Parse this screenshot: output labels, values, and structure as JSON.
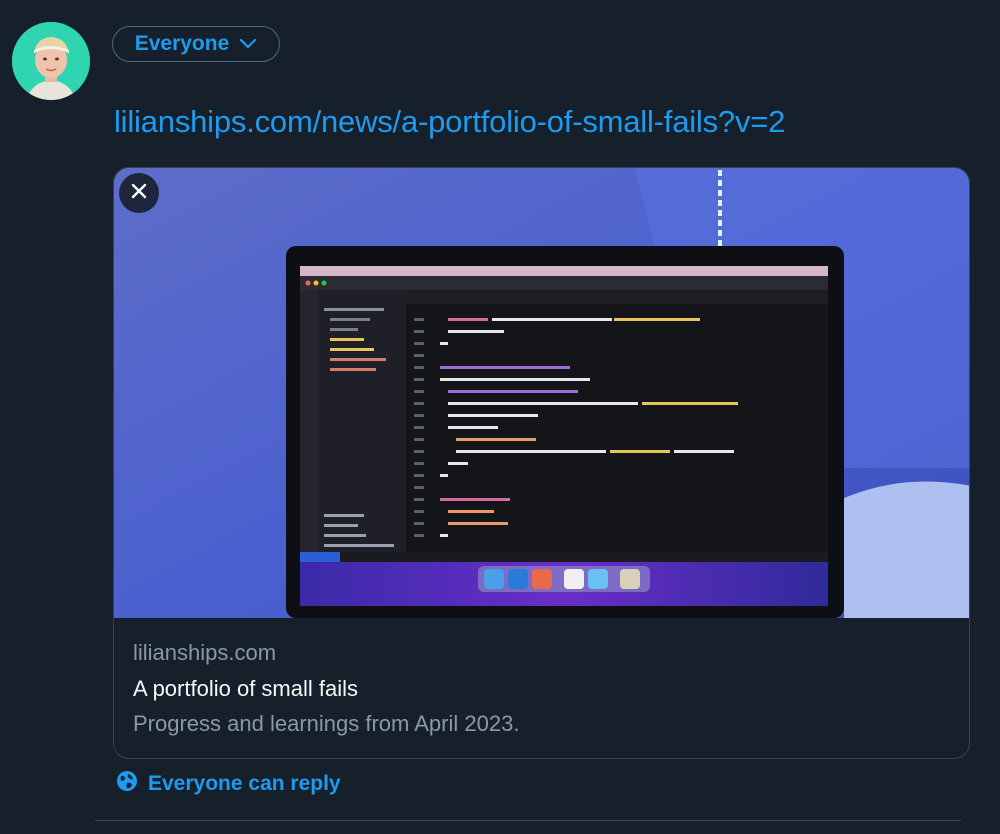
{
  "composer": {
    "avatar_alt": "profile photo",
    "audience_label": "Everyone",
    "link_text": "lilianships.com/news/a-portfolio-of-small-fails?v=2",
    "reply_setting_label": "Everyone can reply"
  },
  "link_card": {
    "domain": "lilianships.com",
    "title": "A portfolio of small fails",
    "description": "Progress and learnings from April 2023."
  },
  "colors": {
    "background": "#15202b",
    "accent": "#1d9bf0",
    "border": "#38444d",
    "muted_text": "#8b98a5",
    "avatar_bg": "#2fd4b1"
  },
  "icons": {
    "audience_chevron": "chevron-down-icon",
    "close": "close-icon",
    "reply": "globe-icon"
  }
}
